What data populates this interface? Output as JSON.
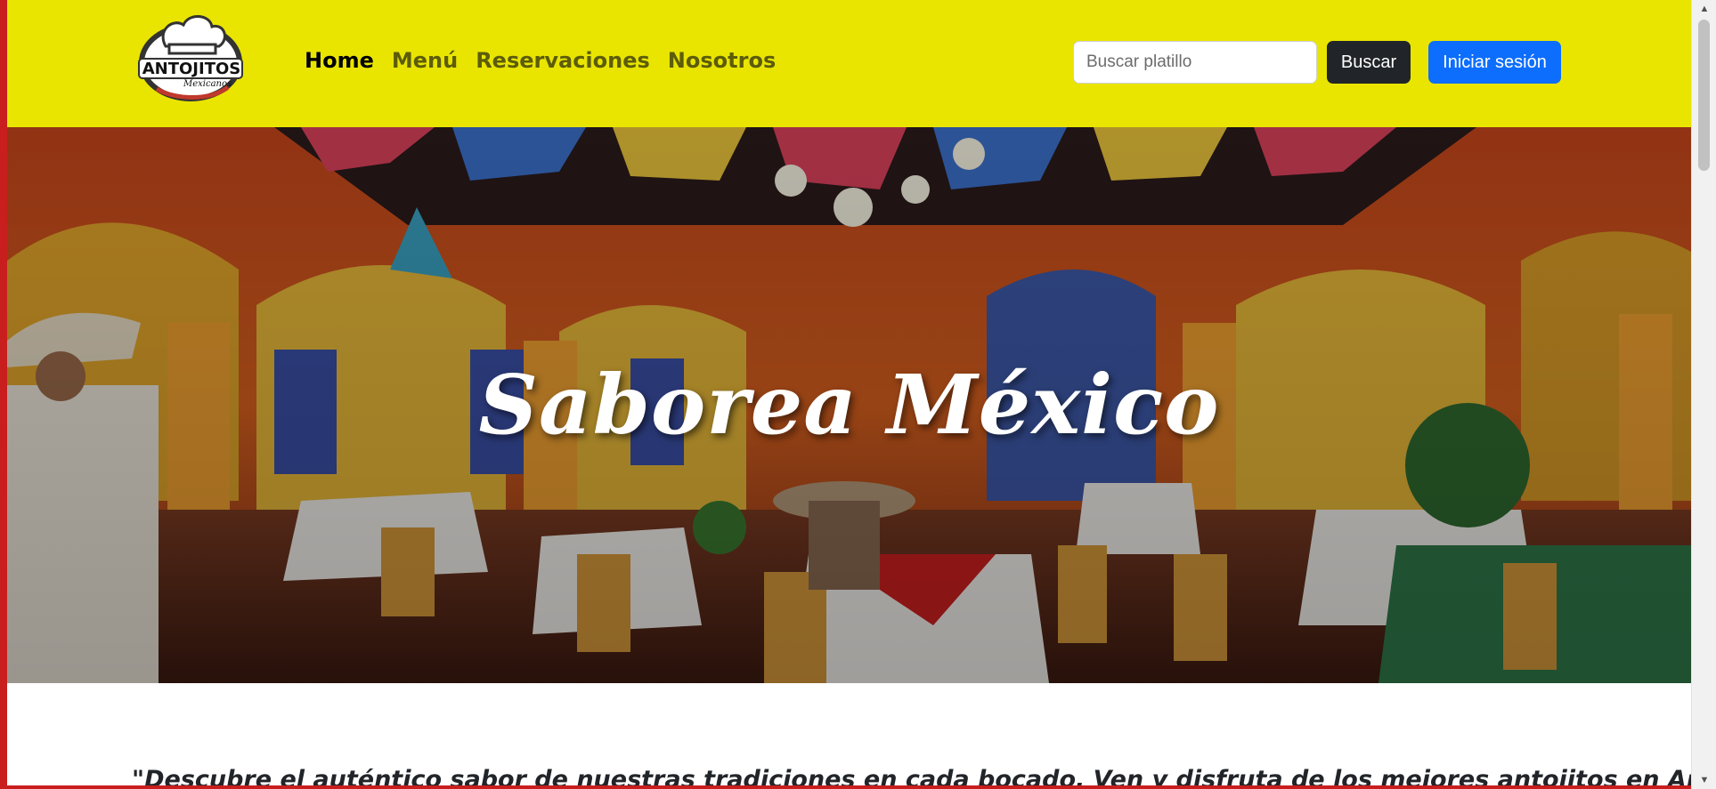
{
  "brand": {
    "logo_line1": "ANTOJITOS",
    "logo_line2": "Mexicanos"
  },
  "nav": {
    "items": [
      {
        "label": "Home",
        "active": true
      },
      {
        "label": "Menú",
        "active": false
      },
      {
        "label": "Reservaciones",
        "active": false
      },
      {
        "label": "Nosotros",
        "active": false
      }
    ]
  },
  "search": {
    "placeholder": "Buscar platillo",
    "value": "",
    "button_label": "Buscar"
  },
  "auth": {
    "login_label": "Iniciar sesión"
  },
  "hero": {
    "title": "Saborea México"
  },
  "quote": {
    "text": "\"Descubre el auténtico sabor de nuestras tradiciones en cada bocado. Ven y disfruta de los mejores antojitos en Antojitos"
  },
  "icons": {
    "chef_logo": "chef-hat-logo-icon",
    "scroll_up": "scroll-up-arrow-icon",
    "scroll_down": "scroll-down-arrow-icon"
  },
  "colors": {
    "navbar_bg": "#e9e500",
    "nav_link": "#5c5c0a",
    "nav_link_active": "#000000",
    "search_button_bg": "#212529",
    "login_button_bg": "#0d6efd",
    "hero_text": "#ffffff",
    "page_edge": "#c81e1e"
  }
}
